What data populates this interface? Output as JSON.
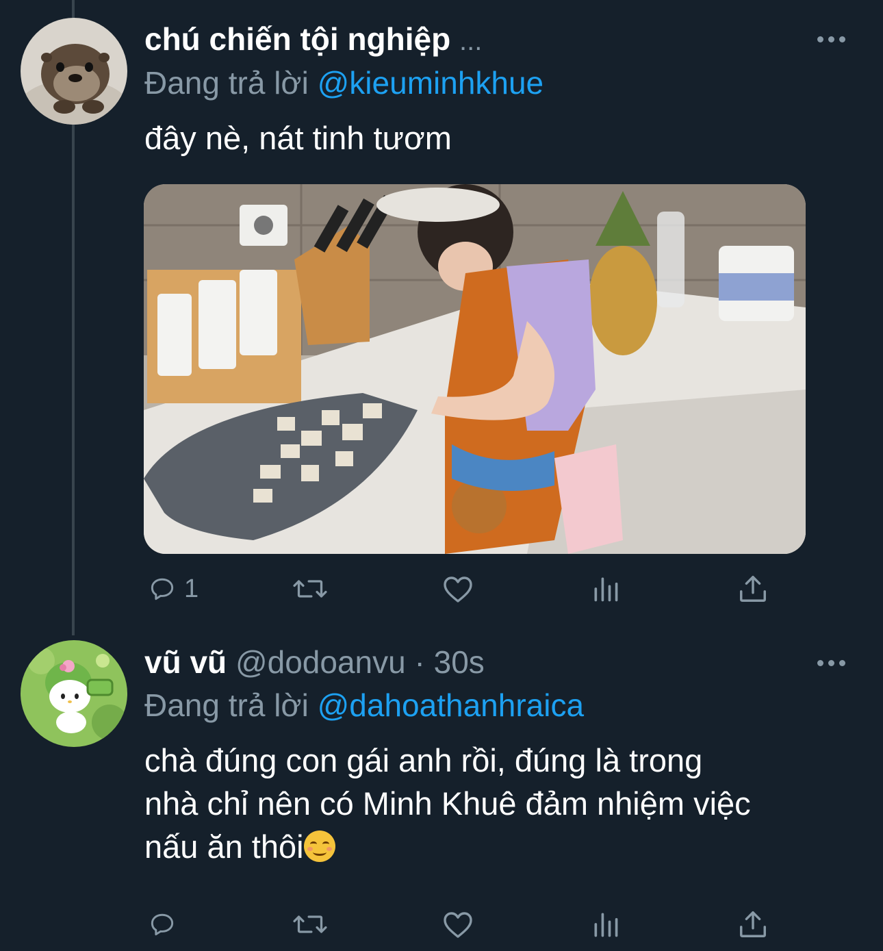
{
  "colors": {
    "background": "#15202b",
    "text_primary": "#ffffff",
    "text_secondary": "#8899a6",
    "accent": "#1da1f2",
    "thread_line": "#38444d"
  },
  "tweets": [
    {
      "name": "chú chiến tội nghiệp",
      "name_overflow": "...",
      "reply_prefix": "Đang trả lời",
      "reply_to": "@kieuminhkhue",
      "text": "đây nè, nát tinh tươm",
      "has_media": true,
      "avatar_icon": "otter-avatar",
      "more_icon": "more-options-icon",
      "actions": {
        "reply_count": "1",
        "icons": [
          "reply-icon",
          "retweet-icon",
          "like-icon",
          "analytics-icon",
          "share-icon"
        ]
      }
    },
    {
      "name": "vũ vũ",
      "handle": "@dodoanvu",
      "separator": "·",
      "time": "30s",
      "reply_prefix": "Đang trả lời",
      "reply_to": "@dahoathanhraica",
      "text_line1": "chà đúng con gái anh rồi, đúng là trong",
      "text_line2": "nhà chỉ nên có Minh Khuê đảm nhiệm việc",
      "text_line3": "nấu ăn thôi",
      "emoji": "smiling-face-emoji",
      "avatar_icon": "hello-kitty-avatar",
      "more_icon": "more-options-icon",
      "actions": {
        "reply_count": "",
        "icons": [
          "reply-icon",
          "retweet-icon",
          "like-icon",
          "analytics-icon",
          "share-icon"
        ]
      }
    }
  ]
}
